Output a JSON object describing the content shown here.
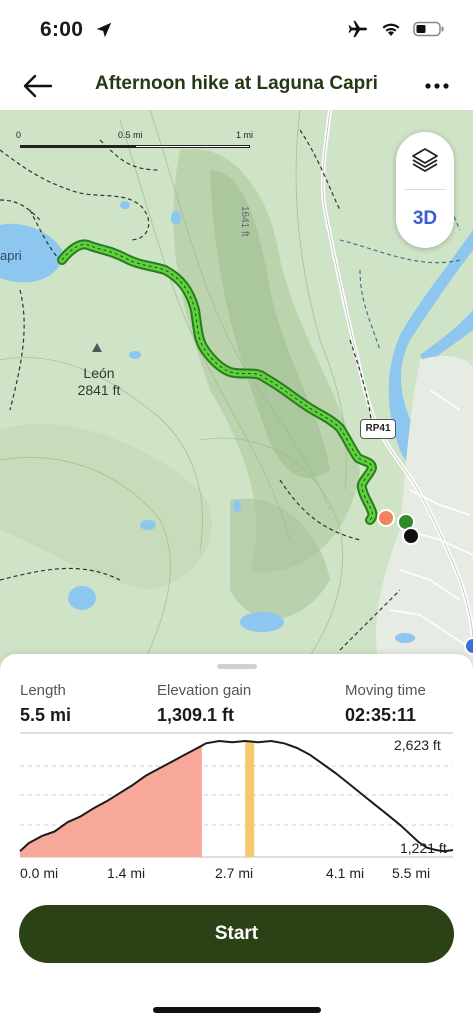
{
  "status": {
    "time": "6:00"
  },
  "header": {
    "title": "Afternoon hike at Laguna Capri"
  },
  "map": {
    "scale": {
      "labels": [
        "0",
        "0.5 mi",
        "1 mi"
      ]
    },
    "controls": {
      "threed_label": "3D"
    },
    "peak": {
      "name": "León",
      "elevation": "2841 ft"
    },
    "lake_label": "apri",
    "contour_label": "1641 ft",
    "road_label": "RP41",
    "colors": {
      "track": "#5fd13f",
      "start_marker": "#f08462",
      "end_marker": "#111111",
      "water": "#8dc6ee",
      "land": "#cfe3c6"
    }
  },
  "stats": {
    "length_label": "Length",
    "length_value": "5.5 mi",
    "gain_label": "Elevation gain",
    "gain_value": "1,309.1 ft",
    "time_label": "Moving time",
    "time_value": "02:35:11"
  },
  "profile": {
    "x_labels": [
      "0.0 mi",
      "1.4 mi",
      "2.7 mi",
      "4.1 mi",
      "5.5 mi"
    ],
    "y_max_label": "2,623 ft",
    "y_min_label": "1,221 ft",
    "progress_fraction": 0.42,
    "marker_fraction": 0.52,
    "colors": {
      "fill": "#f8a898",
      "marker": "#f5c96e",
      "line": "#1b1b1b"
    }
  },
  "actions": {
    "start_label": "Start"
  }
}
